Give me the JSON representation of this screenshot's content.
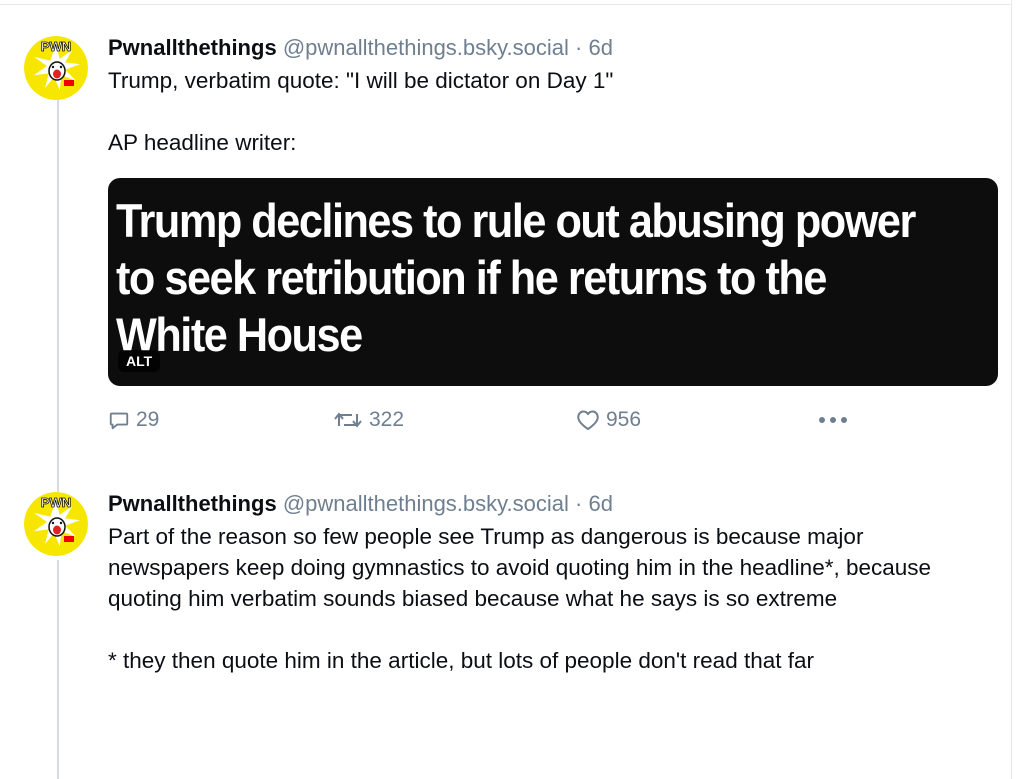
{
  "posts": [
    {
      "author_name": "Pwnallthethings",
      "author_handle": "@pwnallthethings.bsky.social",
      "separator": "·",
      "age": "6d",
      "avatar_text": "PWN",
      "text_lines": [
        "Trump, verbatim quote: \"I will be dictator on Day 1\"",
        "AP headline writer:"
      ],
      "embed": {
        "headline": "Trump declines to rule out abusing power to seek retribution if he returns to the White House",
        "alt_badge": "ALT"
      },
      "counts": {
        "replies": "29",
        "reposts": "322",
        "likes": "956"
      }
    },
    {
      "author_name": "Pwnallthethings",
      "author_handle": "@pwnallthethings.bsky.social",
      "separator": "·",
      "age": "6d",
      "avatar_text": "PWN",
      "text_lines": [
        "Part of the reason so few people see Trump as dangerous is because major newspapers keep doing gymnastics to avoid quoting him in the headline*, because quoting him verbatim sounds biased because what he says is so extreme",
        "* they then quote him in the article, but lots of people don't read that far"
      ]
    }
  ],
  "icons": {
    "reply": "speech-bubble-icon",
    "repost": "repost-arrows-icon",
    "like": "heart-icon",
    "more": "more-dots-icon"
  },
  "colors": {
    "muted": "#6f7f8f",
    "avatar_yellow": "#f6e600",
    "embed_bg": "#0d0d0d"
  }
}
